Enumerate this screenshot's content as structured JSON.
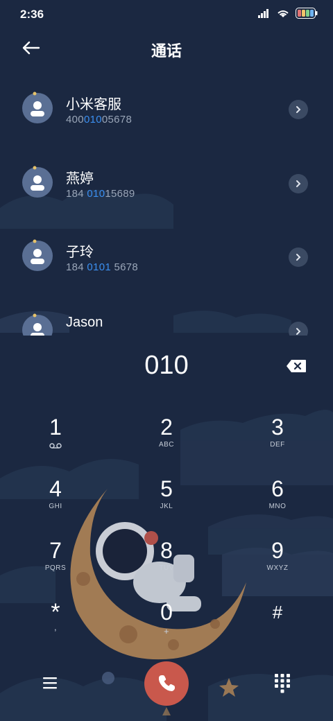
{
  "status": {
    "time": "2:36"
  },
  "header": {
    "title": "通话"
  },
  "contacts": [
    {
      "name": "小米客服",
      "number_parts": [
        "400",
        "010",
        "05678"
      ]
    },
    {
      "name": "燕婷",
      "number_parts": [
        "184 ",
        "010",
        "15689"
      ]
    },
    {
      "name": "子玲",
      "number_parts": [
        "184 ",
        "0101",
        " 5678"
      ]
    },
    {
      "name": "Jason",
      "number_parts": [
        "",
        "",
        ""
      ]
    }
  ],
  "dial": {
    "number": "010"
  },
  "keypad": [
    {
      "digit": "1",
      "letters": ""
    },
    {
      "digit": "2",
      "letters": "ABC"
    },
    {
      "digit": "3",
      "letters": "DEF"
    },
    {
      "digit": "4",
      "letters": "GHI"
    },
    {
      "digit": "5",
      "letters": "JKL"
    },
    {
      "digit": "6",
      "letters": "MNO"
    },
    {
      "digit": "7",
      "letters": "PQRS"
    },
    {
      "digit": "8",
      "letters": "TUV"
    },
    {
      "digit": "9",
      "letters": "WXYZ"
    },
    {
      "digit": "*",
      "letters": ","
    },
    {
      "digit": "0",
      "letters": "+"
    },
    {
      "digit": "#",
      "letters": ""
    }
  ],
  "icons": {
    "back": "arrow-left-icon",
    "backspace": "backspace-icon",
    "voicemail": "voicemail-icon",
    "call": "phone-icon",
    "menu": "menu-icon",
    "dialpad": "dialpad-icon"
  },
  "colors": {
    "background": "#1a2740",
    "highlight": "#3b8ff0",
    "call_button": "#c9584c"
  }
}
